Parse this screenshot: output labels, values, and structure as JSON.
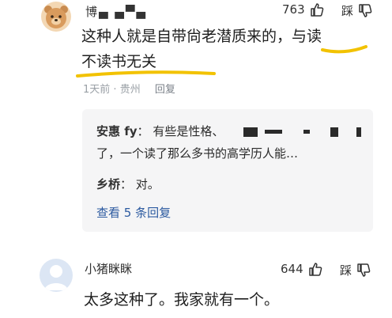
{
  "comments": [
    {
      "username": "博▄ ▄▀▄",
      "likes": "763",
      "dislike_label": "踩",
      "text_line1": "这种人就是自带尙老潜质来的，与读",
      "text_line2": "不读书无关",
      "time": "1天前",
      "location": "贵州",
      "reply_label": "回复",
      "replies": [
        {
          "name": "安惠 fy",
          "text_line1": "有些是性格、",
          "text_line2": "了，一个读了那么多书的高学历人能…"
        },
        {
          "name": "乡桥",
          "text": "对。"
        }
      ],
      "view_more": "查看 5 条回复"
    },
    {
      "username": "小猪眯眯",
      "likes": "644",
      "dislike_label": "踩",
      "text": "太多这种了。我家就有一个。"
    }
  ],
  "colors": {
    "highlight_underline": "#f2c200",
    "link_blue": "#2c5aa0"
  },
  "icons": [
    "bear-avatar",
    "thumbs-up-icon",
    "thumbs-down-icon",
    "default-avatar"
  ]
}
